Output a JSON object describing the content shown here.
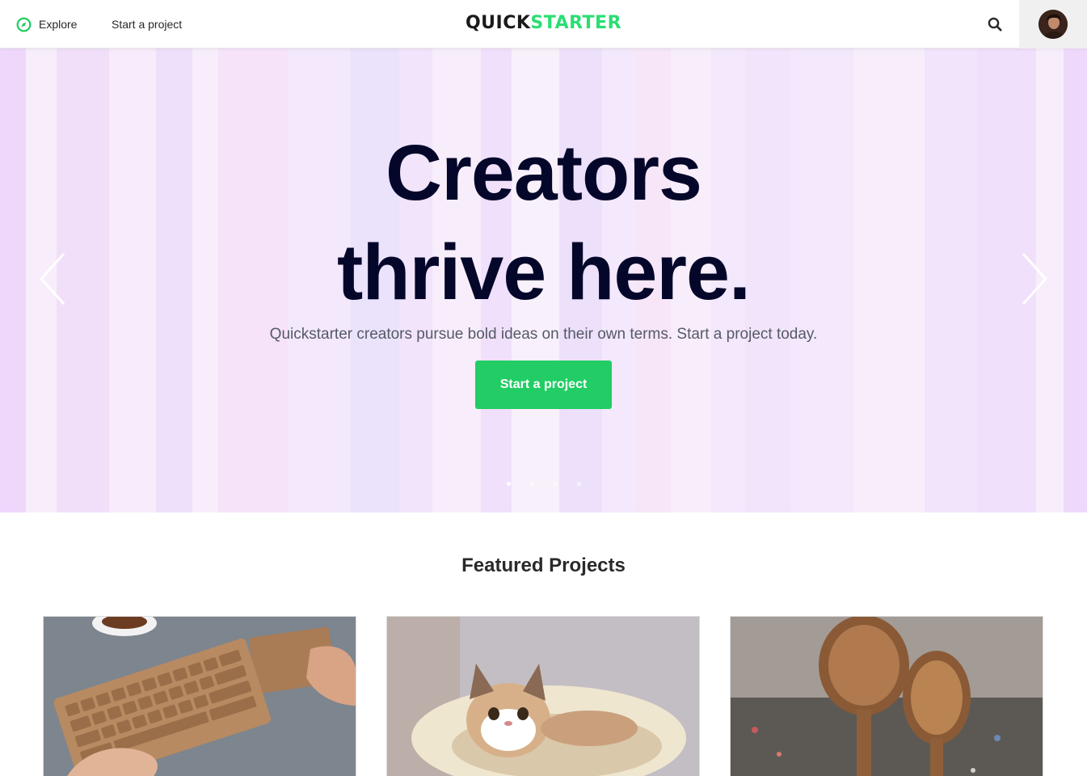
{
  "nav": {
    "explore_label": "Explore",
    "start_label": "Start a project",
    "logo_quick": "QUICK",
    "logo_starter": "STARTER",
    "search_icon": "search-icon",
    "avatar": "user-avatar"
  },
  "hero": {
    "title_line1": "Creators",
    "title_line2": "thrive here.",
    "subtitle": "Quickstarter creators pursue bold ideas on their own terms. Start a project today.",
    "cta_label": "Start a project",
    "slide_count": 4,
    "active_slide": 1
  },
  "featured": {
    "title": "Featured Projects",
    "cards": [
      {
        "image": "wooden-keyboard-photo"
      },
      {
        "image": "grumpy-cat-photo"
      },
      {
        "image": "wooden-spoons-photo"
      }
    ]
  },
  "colors": {
    "accent_green": "#21cd64",
    "logo_green": "#2bde73",
    "hero_text": "#05072a",
    "stripe_palette": [
      "#efd9fb",
      "#f8eefb",
      "#f1dffa",
      "#f4e6fc",
      "#ede0fb",
      "#f7e6f8",
      "#f3e8fc",
      "#ece4fb"
    ]
  }
}
